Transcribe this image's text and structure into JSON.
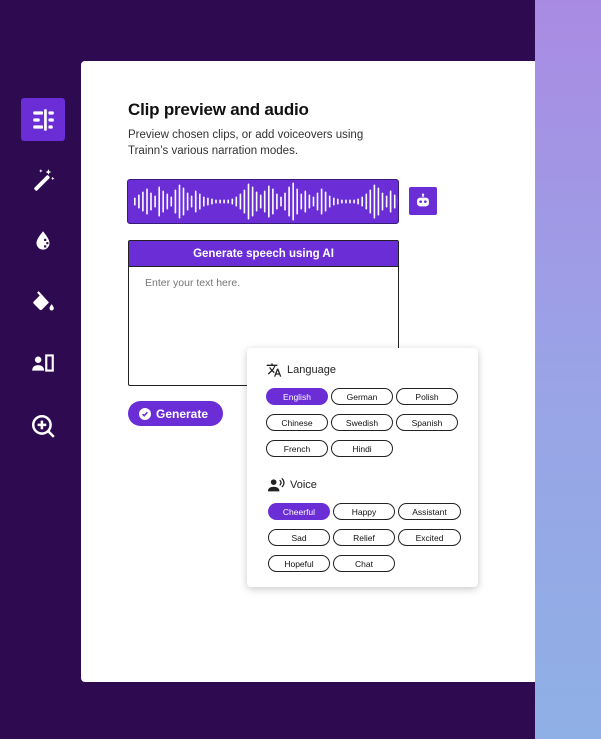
{
  "colors": {
    "accent": "#6a2dd6",
    "background": "#2e0a50"
  },
  "sidebar": {
    "items": [
      {
        "icon": "timeline-icon",
        "active": true
      },
      {
        "icon": "magic-wand-icon",
        "active": false
      },
      {
        "icon": "color-drop-icon",
        "active": false
      },
      {
        "icon": "paint-bucket-icon",
        "active": false
      },
      {
        "icon": "contact-card-icon",
        "active": false
      },
      {
        "icon": "add-search-icon",
        "active": false
      }
    ]
  },
  "main": {
    "title": "Clip preview and audio",
    "description": "Preview chosen clips, or add voiceovers using Trainn’s various narration modes.",
    "tts": {
      "header": "Generate speech using AI",
      "placeholder": "Enter your text here."
    },
    "generate_label": "Generate"
  },
  "popover": {
    "language": {
      "title": "Language",
      "options": [
        "English",
        "German",
        "Polish",
        "Chinese",
        "Swedish",
        "Spanish",
        "French",
        "Hindi"
      ],
      "selected": "English"
    },
    "voice": {
      "title": "Voice",
      "options": [
        "Cheerful",
        "Happy",
        "Assistant",
        "Sad",
        "Relief",
        "Excited",
        "Hopeful",
        "Chat"
      ],
      "selected": "Cheerful"
    }
  }
}
